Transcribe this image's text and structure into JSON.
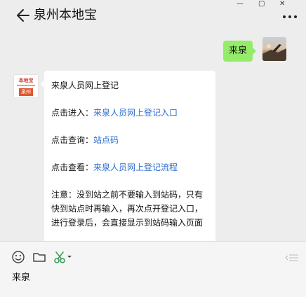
{
  "window": {
    "minimize_glyph": "—",
    "maximize_glyph": "▢",
    "close_glyph": "✕"
  },
  "header": {
    "title": "泉州本地宝",
    "back_icon": "arrow-left-icon",
    "more_icon": "more-dots-icon"
  },
  "chat": {
    "sent": {
      "text": "来泉"
    },
    "bot_avatar": {
      "logo_text": "本地宝",
      "tag_text": "泉州"
    },
    "received": {
      "title": "来泉人员网上登记",
      "enter_prefix": "点击进入：",
      "enter_link": "来泉人员网上登记入口",
      "query_prefix": "点击查询：",
      "query_link": "站点码",
      "view_prefix": "点击查看：",
      "view_link": "来泉人员网上登记流程",
      "note": "注意：没到站之前不要输入到站码，只有快到站点时再输入，再次点开登记入口，进行登录后，会直接显示到站码输入页面"
    }
  },
  "toolbar": {
    "icons": [
      "emoji-icon",
      "folder-icon",
      "scissors-icon",
      "collapse-icon"
    ],
    "accent": "#3aa15a"
  },
  "input": {
    "value": "来泉"
  },
  "colors": {
    "sent_bubble": "#95ec69",
    "link": "#2e6ecf",
    "background": "#ededed"
  }
}
